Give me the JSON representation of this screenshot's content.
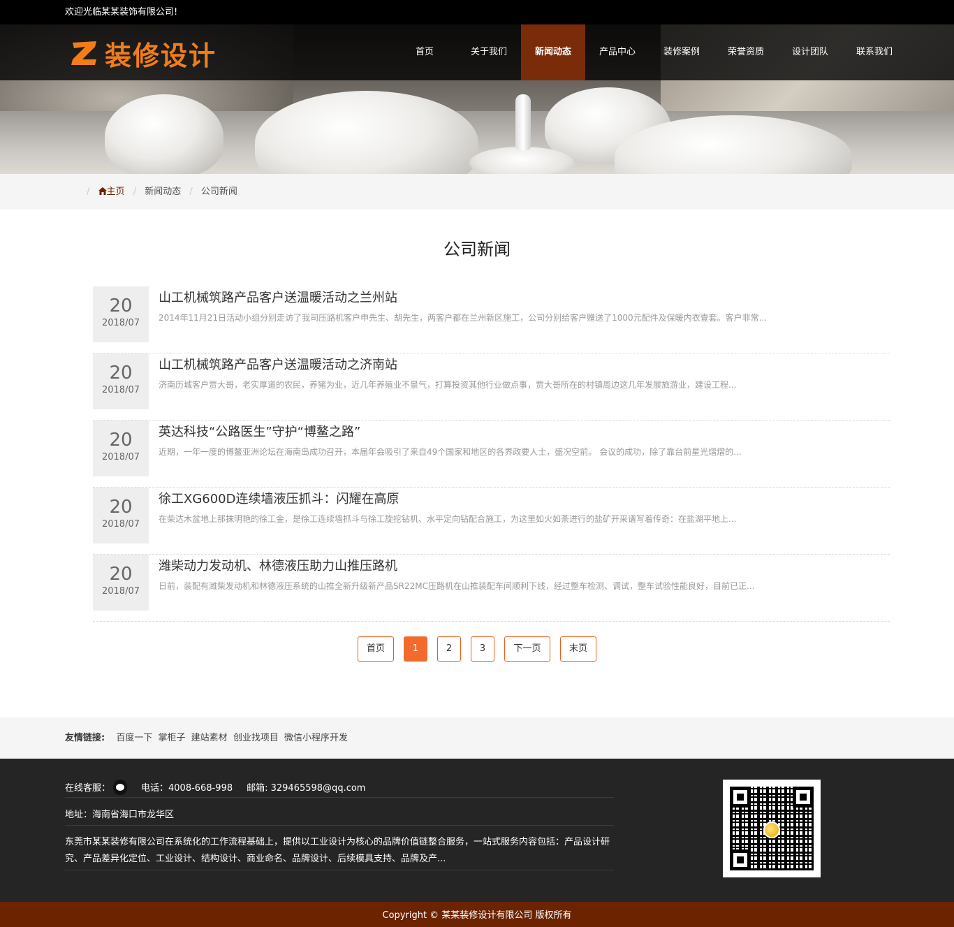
{
  "topbar": {
    "welcome": "欢迎光临某某装饰有限公司!"
  },
  "logo": {
    "text": "装修设计",
    "mark_icon": "z-logo-icon",
    "color": "#f07d1a"
  },
  "nav": [
    {
      "label": "首页"
    },
    {
      "label": "关于我们"
    },
    {
      "label": "新闻动态",
      "active": true
    },
    {
      "label": "产品中心"
    },
    {
      "label": "装修案例"
    },
    {
      "label": "荣誉资质"
    },
    {
      "label": "设计团队"
    },
    {
      "label": "联系我们"
    }
  ],
  "breadcrumb": {
    "home_icon": "home-icon",
    "home": "主页",
    "level1": "新闻动态",
    "level2": "公司新闻"
  },
  "page_title": "公司新闻",
  "news": [
    {
      "day": "20",
      "ym": "2018/07",
      "title": "山工机械筑路产品客户送温暖活动之兰州站",
      "desc": "2014年11月21日活动小组分别走访了我司压路机客户申先生、胡先生，两客户都在兰州新区施工，公司分别给客户赠送了1000元配件及保暖内衣壹套。客户非常..."
    },
    {
      "day": "20",
      "ym": "2018/07",
      "title": "山工机械筑路产品客户送温暖活动之济南站",
      "desc": "济南历城客户贾大哥，老实厚道的农民，养猪为业，近几年养殖业不景气，打算投资其他行业做点事，贾大哥所在的村镇周边这几年发展旅游业，建设工程..."
    },
    {
      "day": "20",
      "ym": "2018/07",
      "title": "英达科技“公路医生”守护“博鳌之路”",
      "desc": "近期，一年一度的博鳌亚洲论坛在海南岛成功召开，本届年会吸引了来自49个国家和地区的各界政要人士，盛况空前。 会议的成功，除了靠台前星光熠熠的..."
    },
    {
      "day": "20",
      "ym": "2018/07",
      "title": "徐工XG600D连续墙液压抓斗：闪耀在高原",
      "desc": "在柴达木盆地上那抹明艳的徐工金，是徐工连续墙抓斗与徐工旋挖钻机、水平定向钻配合施工，为这里如火如荼进行的盐矿开采谱写着传奇：在盐湖平地上..."
    },
    {
      "day": "20",
      "ym": "2018/07",
      "title": "潍柴动力发动机、林德液压助力山推压路机",
      "desc": "日前，装配有潍柴发动机和林德液压系统的山推全新升级新产品SR22MC压路机在山推装配车间顺利下线，经过整车检测、调试，整车试验性能良好，目前已正..."
    }
  ],
  "pager": {
    "first": "首页",
    "pages": [
      "1",
      "2",
      "3"
    ],
    "current": "1",
    "next": "下一页",
    "last": "末页",
    "accent": "#f26b2d"
  },
  "links": {
    "label": "友情链接:",
    "items": [
      "百度一下",
      "掌柜子",
      "建站素材",
      "创业找项目",
      "微信小程序开发"
    ]
  },
  "footer": {
    "service_label": "在线客服：",
    "qq_icon": "qq-icon",
    "phone": "电话：4008-668-998",
    "email": "邮箱: 329465598@qq.com",
    "address": "地址：海南省海口市龙华区",
    "about": "东莞市某某装修有限公司在系统化的工作流程基础上，提供以工业设计为核心的品牌价值链整合服务，一站式服务内容包括：产品设计研究、产品差异化定位、工业设计、结构设计、商业命名、品牌设计、后续模具支持、品牌及产...",
    "qr_icon": "qr-code-icon"
  },
  "copyright": "Copyright © 某某装修设计有限公司 版权所有",
  "colors": {
    "brand_dark": "#6b2300",
    "nav_active": "#7a2c0a",
    "footer_bg": "#252525"
  }
}
